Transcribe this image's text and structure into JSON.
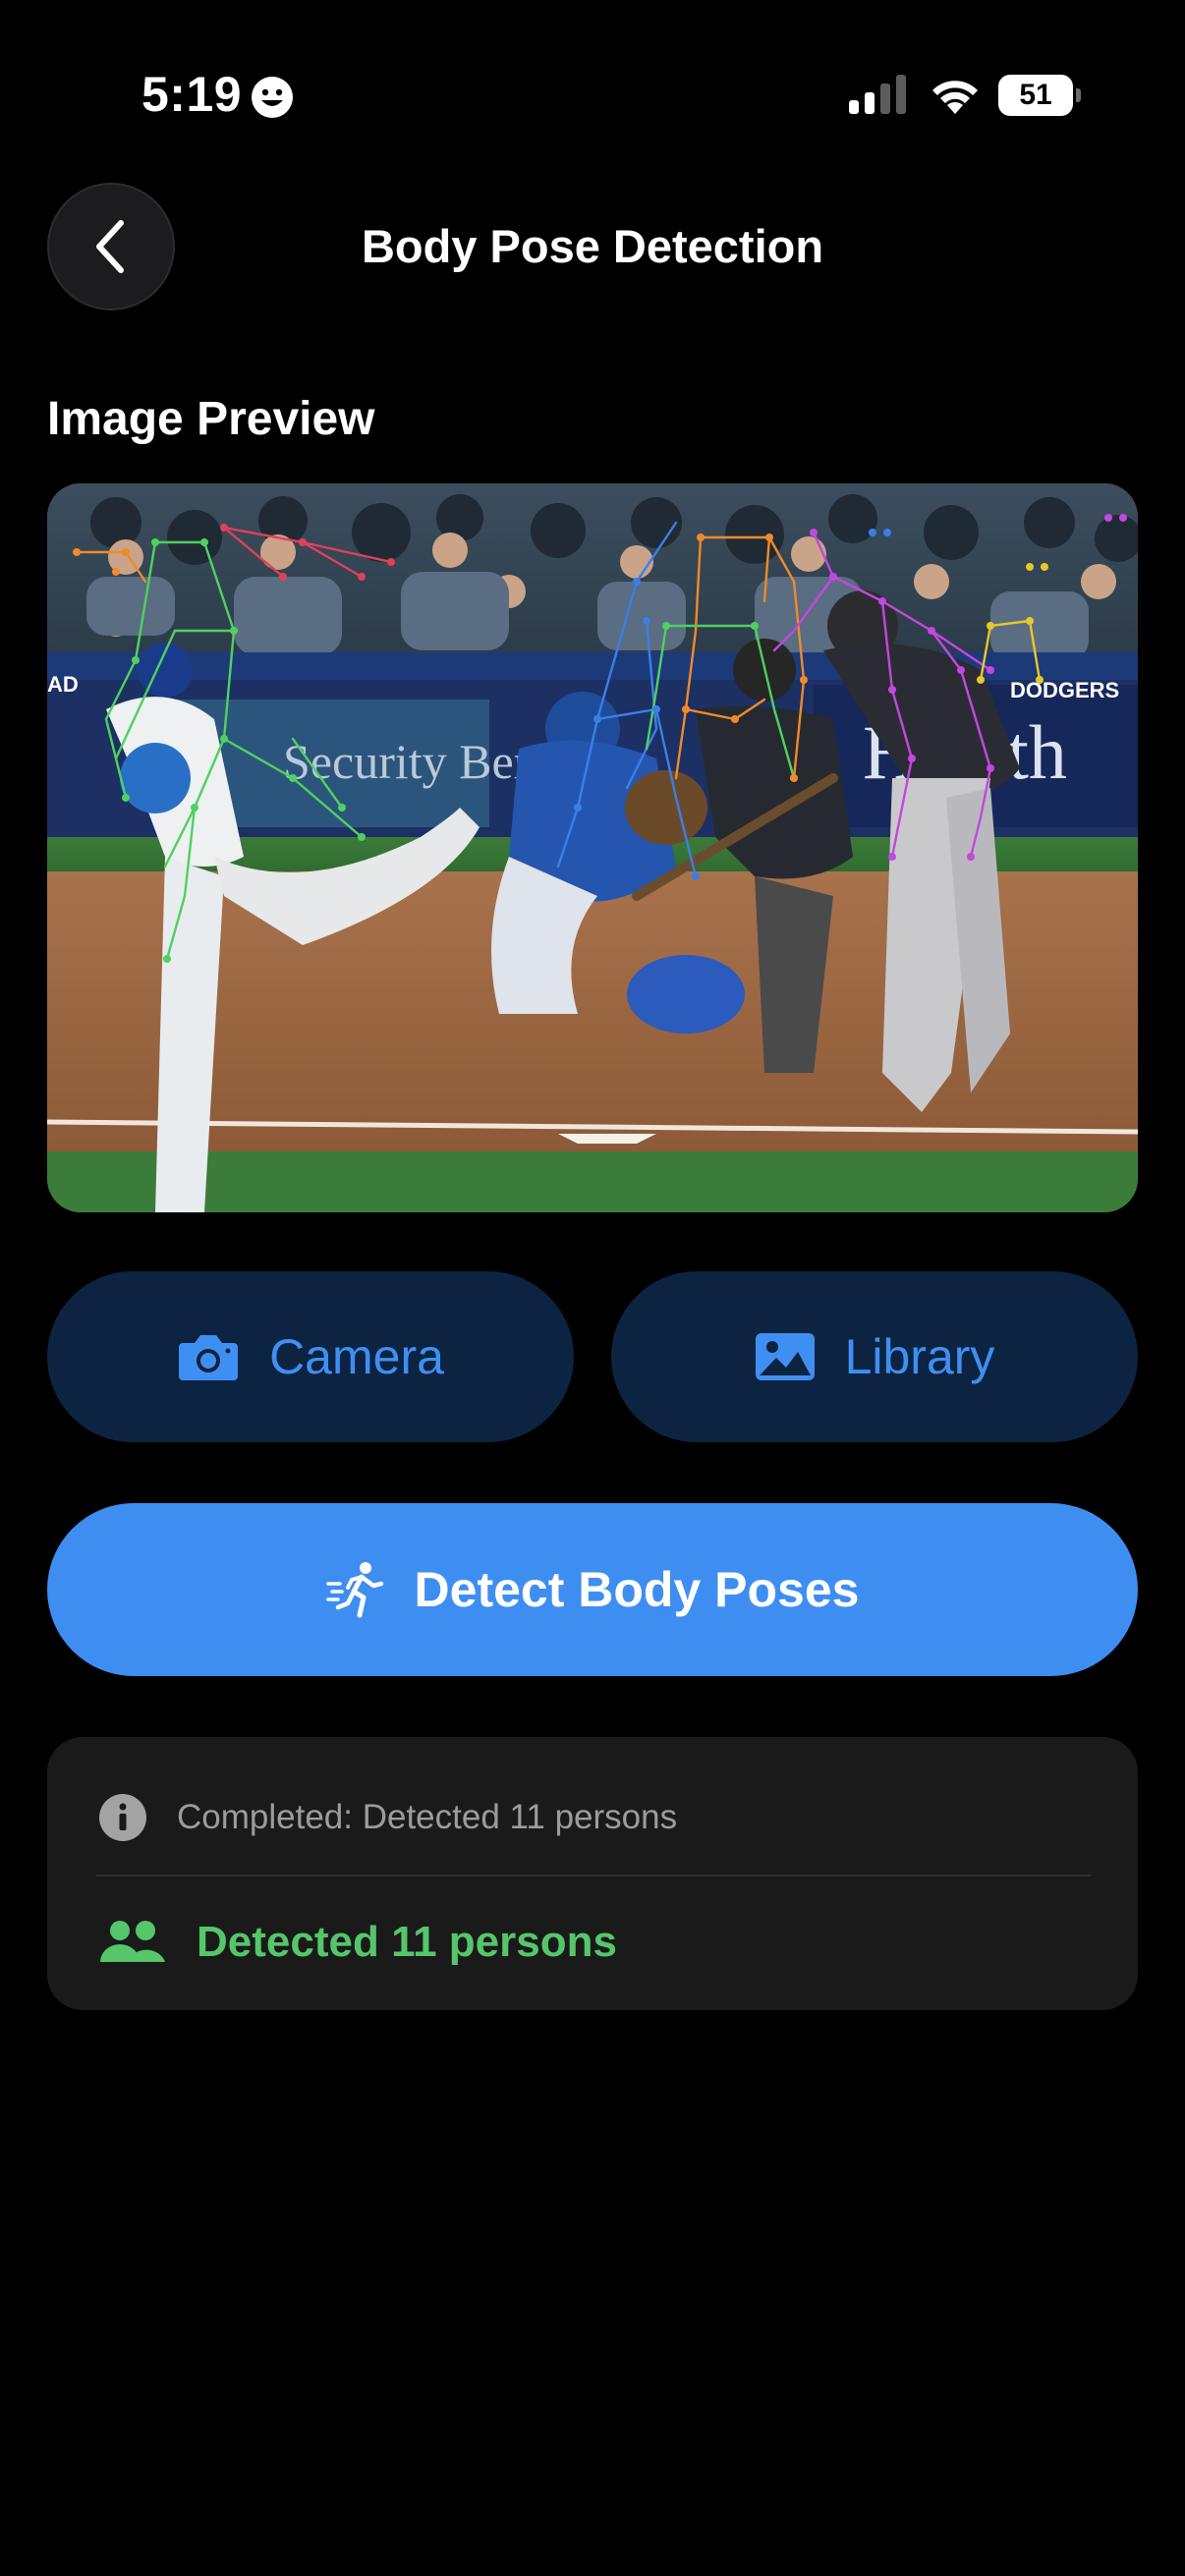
{
  "status_bar": {
    "time": "5:19",
    "battery": "51"
  },
  "nav": {
    "title": "Body Pose Detection",
    "back_icon": "chevron-left-icon"
  },
  "preview": {
    "section_title": "Image Preview",
    "banner_left": "Security Benefit",
    "banner_right": "Health",
    "sign_left": "AD",
    "sign_right": "DODGERS"
  },
  "buttons": {
    "camera_label": "Camera",
    "camera_icon": "camera-icon",
    "library_label": "Library",
    "library_icon": "photo-icon",
    "detect_label": "Detect Body Poses",
    "detect_icon": "running-person-icon"
  },
  "result": {
    "status_text": "Completed: Detected 11 persons",
    "status_icon": "info-icon",
    "result_text": "Detected 11 persons",
    "result_icon": "people-icon"
  },
  "colors": {
    "accent": "#3e8ef2",
    "accent_dark_bg": "#0c2441",
    "success": "#55c66a",
    "card_bg": "#1a1a1a"
  }
}
